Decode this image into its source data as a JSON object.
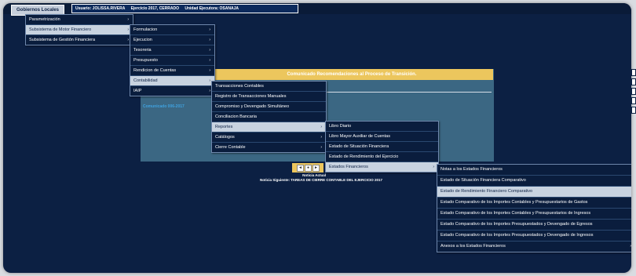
{
  "header": {
    "gobiernos_btn": "Gobiernos Locales",
    "usuario": "Usuario: JOLISSA.RIVERA",
    "ejercicio": "Ejercicio 2017, CERRADO",
    "unidad": "Unidad Ejecutora: OSANAJA"
  },
  "banner": "Comunicado Recomendaciones al Proceso de Transición.",
  "comunicado_link": "Comunicado 006-2017",
  "pager": {
    "prev": "◄",
    "current": "●",
    "next": "►"
  },
  "notice": {
    "actual_label": "Noticia Actual",
    "siguiente": "Noticia Siguiente: TAREAS DE CIERRE CONTABLE DEL EJERCICIO 2017"
  },
  "menus": {
    "m1": [
      "Parametrización",
      "Subsistema de Motor Financiero",
      "Subsistema de Gestión Financiera"
    ],
    "m2": [
      "Formulacion",
      "Ejecucion",
      "Tesoreria",
      "Presupuesto",
      "Rendicion de Cuentas",
      "Contabilidad",
      "IAIP"
    ],
    "m3": [
      "Transacciones Contables",
      "Registro de Transacciones Manuales",
      "Compromiso y Devengado Simultáneo",
      "Conciliacion Bancaria",
      "Reportes",
      "Catálogos",
      "Cierre Contable"
    ],
    "m4": [
      "Libro Diario",
      "Libro Mayor Auxiliar de Cuentas",
      "Estado de Situación Financiera",
      "Estado de Rendimiento del Ejercicio",
      "Estados Financieros"
    ],
    "m5": [
      "Notas a los Estados Financieros",
      "Estado de Situación Financiera Comparativo",
      "Estado de Rendimiento Financiero Comparativo",
      "Estado Comparativo de los Importes Contables y Presupuestarios de Gastos",
      "Estado Comparativo de los Importes Contables y Presupuestarios de Ingresos",
      "Estado Comparativo de los Importes Presupuestados y Devengado de Egresos",
      "Estado Comparativo de los Importes Presupuestados y Devengado de Ingresos",
      "Anexos a los Estados Financieros"
    ]
  },
  "menu_state": {
    "m1": {
      "selected": 1,
      "submenu": [
        0,
        1,
        2
      ]
    },
    "m2": {
      "selected": 5,
      "submenu": [
        0,
        1,
        2,
        3,
        4,
        5,
        6
      ]
    },
    "m3": {
      "selected": 4,
      "submenu": [
        4,
        5,
        6
      ]
    },
    "m4": {
      "selected": 4,
      "submenu": [
        4
      ]
    },
    "m5": {
      "selected": 2,
      "submenu": [
        7
      ]
    }
  },
  "colors": {
    "background": "#0c2043",
    "banner": "#ecc65d",
    "panel": "#3b6783",
    "menu_bg": "#0a1d3d",
    "selected_bg": "#c8d3e0",
    "link": "#3fa2e0"
  }
}
